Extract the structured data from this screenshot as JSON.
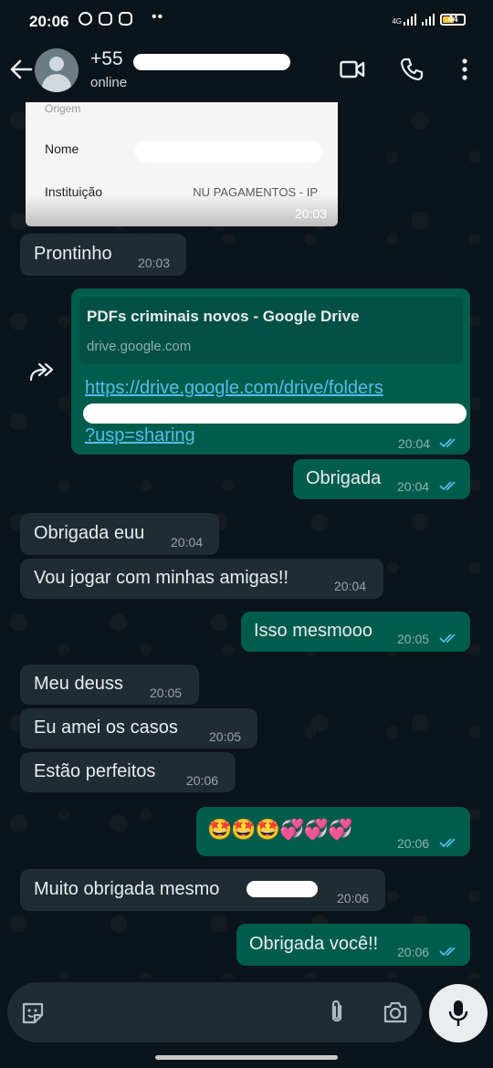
{
  "status_bar": {
    "time": "20:06",
    "network": "4G",
    "battery": "44"
  },
  "header": {
    "name": "+55",
    "status": "online"
  },
  "receipt": {
    "origem": "Origem",
    "rows": [
      {
        "label": "Nome",
        "value": ""
      },
      {
        "label": "Instituição",
        "value": "NU PAGAMENTOS - IP"
      }
    ],
    "time": "20:03"
  },
  "messages": [
    {
      "text": "Prontinho",
      "time": "20:03"
    },
    {
      "preview_title": "PDFs criminais novos - Google Drive",
      "preview_domain": "drive.google.com",
      "link_line1": "https://drive.google.com/drive/folders",
      "link_line3": "?usp=sharing",
      "time": "20:04"
    },
    {
      "text": "Obrigada",
      "time": "20:04"
    },
    {
      "text": "Obrigada euu",
      "time": "20:04"
    },
    {
      "text": "Vou jogar com minhas amigas!!",
      "time": "20:04"
    },
    {
      "text": "Isso mesmooo",
      "time": "20:05"
    },
    {
      "text": "Meu deuss",
      "time": "20:05"
    },
    {
      "text": "Eu amei os casos",
      "time": "20:05"
    },
    {
      "text": "Estão perfeitos",
      "time": "20:06"
    },
    {
      "text": "🤩🤩🤩💞💞💞",
      "time": "20:06"
    },
    {
      "text": "Muito obrigada mesmo",
      "time": "20:06"
    },
    {
      "text": "Obrigada você!!",
      "time": "20:06"
    }
  ],
  "icons": {
    "header": [
      "back-arrow-icon",
      "video-call-icon",
      "phone-icon",
      "more-options-icon"
    ],
    "composer": [
      "sticker-icon",
      "attach-icon",
      "camera-icon",
      "mic-icon"
    ]
  },
  "colors": {
    "incoming": "#202c33",
    "outgoing": "#005c4b",
    "link": "#53bdeb",
    "ticks": "#53bdeb",
    "background": "#0b141a"
  }
}
